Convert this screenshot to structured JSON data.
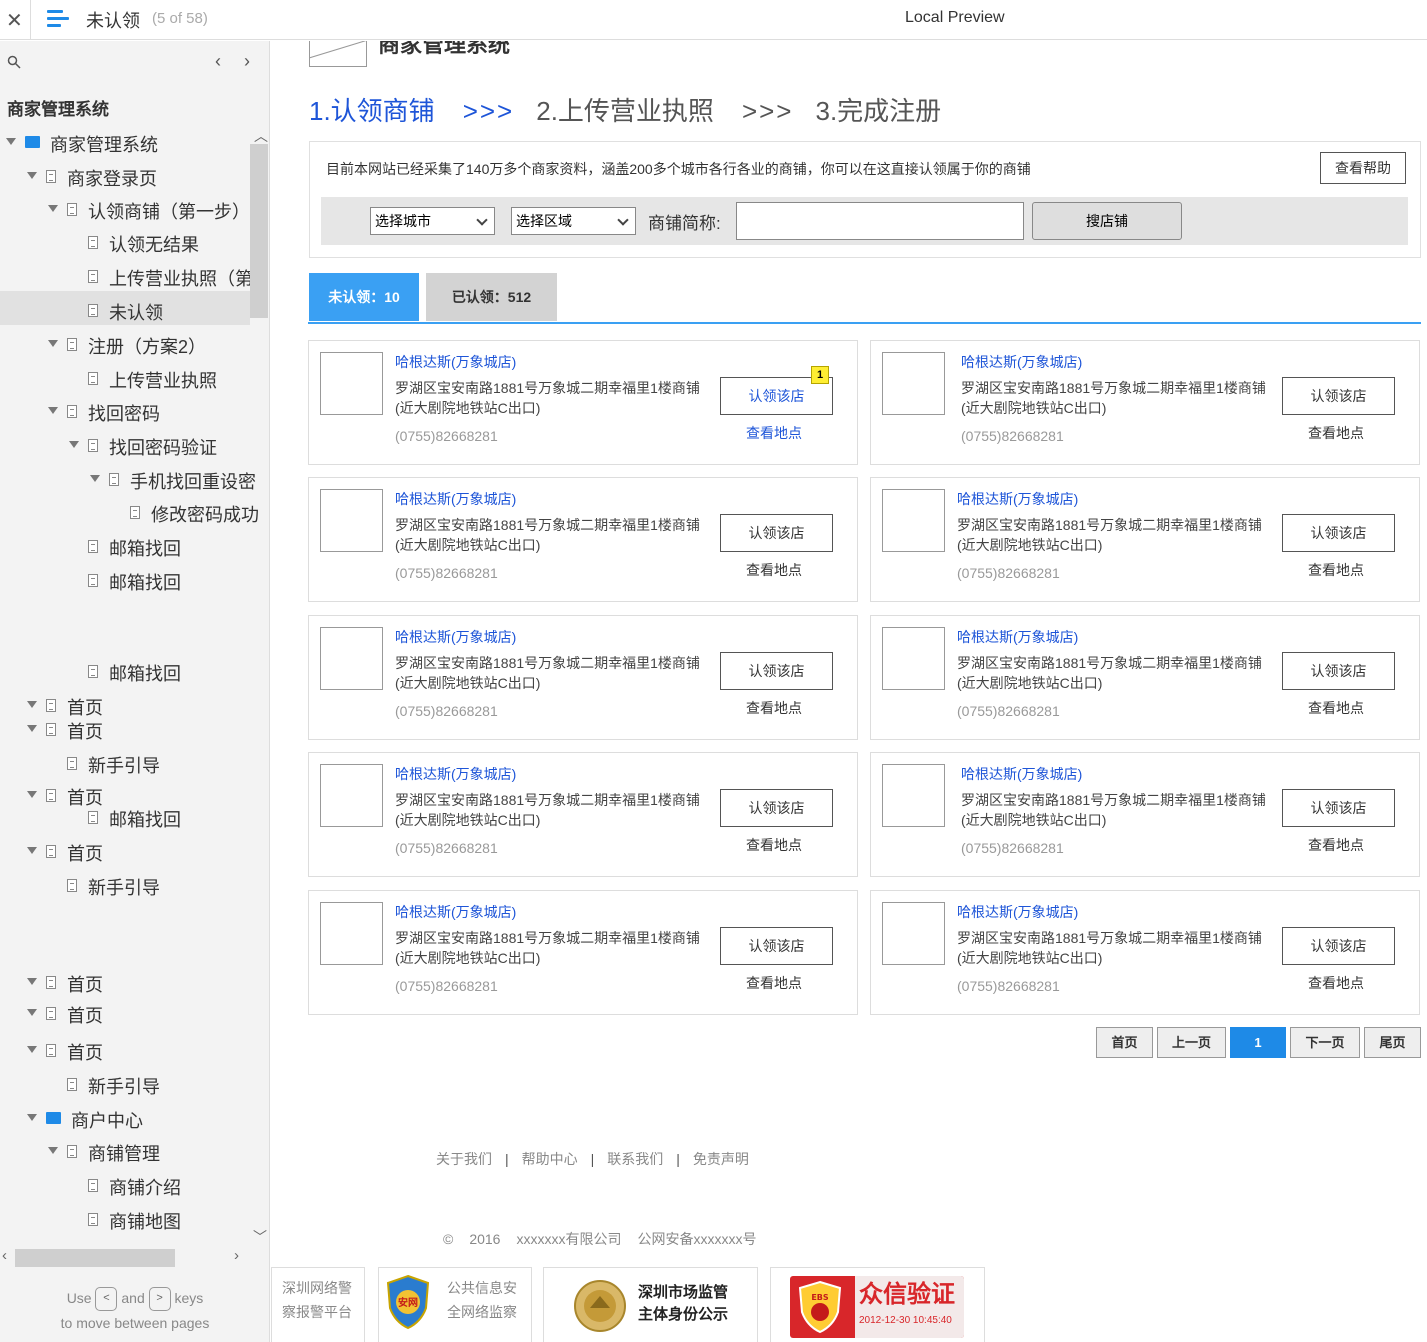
{
  "topbar": {
    "title": "未认领",
    "count": "(5 of 58)",
    "center": "Local Preview"
  },
  "sidebar": {
    "heading": "商家管理系统",
    "hint_use": "Use",
    "hint_and": "and",
    "hint_keys": "keys",
    "hint_line2": "to move between pages",
    "items": [
      {
        "label": "商家管理系统",
        "type": "folder",
        "indent": 0,
        "arrow": true
      },
      {
        "label": "商家登录页",
        "type": "page",
        "indent": 1,
        "arrow": true
      },
      {
        "label": "认领商铺（第一步）",
        "type": "page",
        "indent": 2,
        "arrow": true
      },
      {
        "label": "认领无结果",
        "type": "page",
        "indent": 3,
        "arrow": false
      },
      {
        "label": "上传营业执照（第",
        "type": "page",
        "indent": 3,
        "arrow": false
      },
      {
        "label": "未认领",
        "type": "page",
        "indent": 3,
        "arrow": false
      },
      {
        "label": "注册（方案2）",
        "type": "page",
        "indent": 2,
        "arrow": true
      },
      {
        "label": "上传营业执照",
        "type": "page",
        "indent": 3,
        "arrow": false
      },
      {
        "label": "找回密码",
        "type": "page",
        "indent": 2,
        "arrow": true
      },
      {
        "label": "找回密码验证",
        "type": "page",
        "indent": 3,
        "arrow": true
      },
      {
        "label": "手机找回重设密",
        "type": "page",
        "indent": 4,
        "arrow": true
      },
      {
        "label": "修改密码成功",
        "type": "page",
        "indent": 5,
        "arrow": false
      },
      {
        "label": "邮箱找回",
        "type": "page",
        "indent": 3,
        "arrow": false
      },
      {
        "label": "邮箱找回",
        "type": "page",
        "indent": 3,
        "arrow": false
      },
      {
        "label": "邮箱找回",
        "type": "page",
        "indent": 3,
        "arrow": false
      },
      {
        "label": "首页",
        "type": "page",
        "indent": 1,
        "arrow": true
      },
      {
        "label": "首页",
        "type": "page",
        "indent": 1,
        "arrow": true
      },
      {
        "label": "新手引导",
        "type": "page",
        "indent": 2,
        "arrow": false
      },
      {
        "label": "首页",
        "type": "page",
        "indent": 1,
        "arrow": true
      },
      {
        "label": "邮箱找回",
        "type": "page",
        "indent": 3,
        "arrow": false
      },
      {
        "label": "首页",
        "type": "page",
        "indent": 1,
        "arrow": true
      },
      {
        "label": "新手引导",
        "type": "page",
        "indent": 2,
        "arrow": false
      },
      {
        "label": "首页",
        "type": "page",
        "indent": 1,
        "arrow": true
      },
      {
        "label": "首页",
        "type": "page",
        "indent": 1,
        "arrow": true
      },
      {
        "label": "首页",
        "type": "page",
        "indent": 1,
        "arrow": true
      },
      {
        "label": "新手引导",
        "type": "page",
        "indent": 2,
        "arrow": false
      },
      {
        "label": "商户中心",
        "type": "folder",
        "indent": 1,
        "arrow": true
      },
      {
        "label": "商铺管理",
        "type": "page",
        "indent": 2,
        "arrow": true
      },
      {
        "label": "商铺介绍",
        "type": "page",
        "indent": 3,
        "arrow": false
      },
      {
        "label": "商铺地图",
        "type": "page",
        "indent": 3,
        "arrow": false
      }
    ]
  },
  "main": {
    "logo_text": "logo",
    "system_title": "商家管理系统",
    "steps": {
      "step1": "1.认领商铺",
      "sep1": ">>>",
      "step2": "2.上传营业执照",
      "sep2": ">>>",
      "step3": "3.完成注册"
    },
    "intro": "目前本网站已经采集了140万多个商家资料，涵盖200多个城市各行各业的商铺，你可以在这直接认领属于你的商铺",
    "help_button": "查看帮助",
    "city_select": "选择城市",
    "area_select": "选择区域",
    "shop_name_label": "商铺简称:",
    "shop_name_value": "",
    "search_button": "搜店铺",
    "tab_unclaimed": "未认领：10",
    "tab_claimed": "已认领：512",
    "cards": [
      {
        "name": "哈根达斯(万象城店)",
        "addr": "罗湖区宝安南路1881号万象城二期幸福里1楼商铺(近大剧院地铁站C出口)",
        "phone": "(0755)82668281",
        "claim": "认领该店",
        "map": "查看地点",
        "badge": "1"
      },
      {
        "name": "哈根达斯(万象城店)",
        "addr": "罗湖区宝安南路1881号万象城二期幸福里1楼商铺(近大剧院地铁站C出口)",
        "phone": "(0755)82668281",
        "claim": "认领该店",
        "map": "查看地点"
      },
      {
        "name": "哈根达斯(万象城店)",
        "addr": "罗湖区宝安南路1881号万象城二期幸福里1楼商铺(近大剧院地铁站C出口)",
        "phone": "(0755)82668281",
        "claim": "认领该店",
        "map": "查看地点"
      },
      {
        "name": "哈根达斯(万象城店)",
        "addr": "罗湖区宝安南路1881号万象城二期幸福里1楼商铺(近大剧院地铁站C出口)",
        "phone": "(0755)82668281",
        "claim": "认领该店",
        "map": "查看地点"
      },
      {
        "name": "哈根达斯(万象城店)",
        "addr": "罗湖区宝安南路1881号万象城二期幸福里1楼商铺(近大剧院地铁站C出口)",
        "phone": "(0755)82668281",
        "claim": "认领该店",
        "map": "查看地点"
      },
      {
        "name": "哈根达斯(万象城店)",
        "addr": "罗湖区宝安南路1881号万象城二期幸福里1楼商铺(近大剧院地铁站C出口)",
        "phone": "(0755)82668281",
        "claim": "认领该店",
        "map": "查看地点"
      },
      {
        "name": "哈根达斯(万象城店)",
        "addr": "罗湖区宝安南路1881号万象城二期幸福里1楼商铺(近大剧院地铁站C出口)",
        "phone": "(0755)82668281",
        "claim": "认领该店",
        "map": "查看地点"
      },
      {
        "name": "哈根达斯(万象城店)",
        "addr": "罗湖区宝安南路1881号万象城二期幸福里1楼商铺(近大剧院地铁站C出口)",
        "phone": "(0755)82668281",
        "claim": "认领该店",
        "map": "查看地点"
      },
      {
        "name": "哈根达斯(万象城店)",
        "addr": "罗湖区宝安南路1881号万象城二期幸福里1楼商铺(近大剧院地铁站C出口)",
        "phone": "(0755)82668281",
        "claim": "认领该店",
        "map": "查看地点"
      },
      {
        "name": "哈根达斯(万象城店)",
        "addr": "罗湖区宝安南路1881号万象城二期幸福里1楼商铺(近大剧院地铁站C出口)",
        "phone": "(0755)82668281",
        "claim": "认领该店",
        "map": "查看地点"
      }
    ],
    "pagination": {
      "first": "首页",
      "prev": "上一页",
      "current": "1",
      "next": "下一页",
      "last": "尾页"
    },
    "footer_links": [
      "关于我们",
      "帮助中心",
      "联系我们",
      "免责声明"
    ],
    "footer_sep": "|",
    "copyright": {
      "symbol": "©",
      "year": "2016",
      "company": "xxxxxxx有限公司",
      "icp": "公网安备xxxxxxx号"
    },
    "badges": {
      "police_line1": "深圳网络警",
      "police_line2": "察报警平台",
      "security_line1": "公共信息安",
      "security_line2": "全网络监察",
      "security_emblem": "安网",
      "market_line1": "深圳市场监管",
      "market_line2": "主体身份公示",
      "verify_title": "众信验证",
      "verify_emblem": "EBS",
      "verify_date": "2012-12-30 10:45:40"
    }
  },
  "colors": {
    "accent": "#1e8ae7",
    "link": "#1e55d8",
    "tab_active": "#3aa0f3",
    "badge_yellow": "#ffee33",
    "verify_red": "#d8262a"
  }
}
